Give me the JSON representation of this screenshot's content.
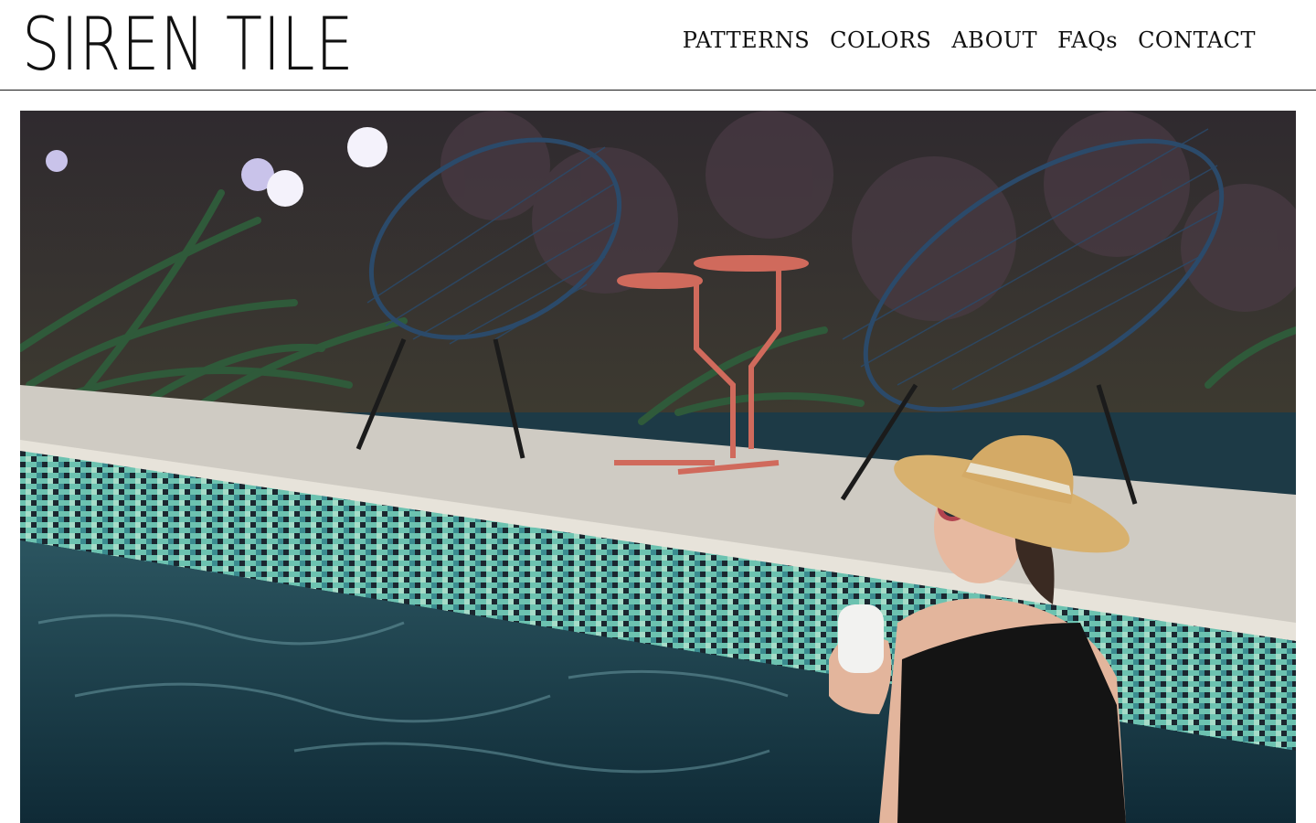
{
  "brand": {
    "logo_text": "SIREN TILE",
    "logo_icon": "siren-tile-s-mark-icon"
  },
  "nav": {
    "items": [
      {
        "label": "PATTERNS"
      },
      {
        "label": "COLORS"
      },
      {
        "label": "ABOUT"
      },
      {
        "label": "FAQs"
      },
      {
        "label": "CONTACT"
      }
    ]
  },
  "hero": {
    "description_icon": "pool-hero-photo"
  },
  "colors": {
    "text": "#111111",
    "background": "#ffffff",
    "pool_water": "#1d3a46",
    "tile_teal": "#5fb7a8",
    "tile_dark": "#1b2730",
    "chair_blue": "#2b4a6a",
    "table_coral": "#d06a5c"
  }
}
